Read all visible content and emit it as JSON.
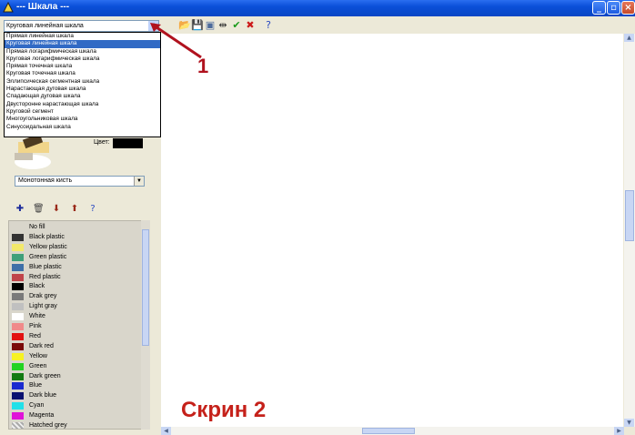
{
  "window": {
    "title": "--- Шкала ---",
    "min_glyph": "_",
    "max_glyph": "▫",
    "close_glyph": "×"
  },
  "scale_type": {
    "selected": "Круговая линейная шкала",
    "options": [
      "Прямая линейная шкала",
      "Круговая линейная шкала",
      "Прямая логарифмическая шкала",
      "Круговая логарифмическая шкала",
      "Прямая точечная шкала",
      "Круговая точечная шкала",
      "Эллипсическая сегментная шкала",
      "Нарастающая дуговая шкала",
      "Спадающая дуговая шкала",
      "Двусторонне нарастающая шкала",
      "Круговой сегмент",
      "Многоугольниковая шкала",
      "Синусоидальная шкала"
    ],
    "highlighted_index": 1
  },
  "toolbar": {
    "icons": [
      "open-icon",
      "save-icon",
      "copy-icon",
      "fit-icon",
      "ok-icon",
      "delete-icon",
      "help-icon"
    ],
    "glyphs": [
      "📂",
      "💾",
      "▣",
      "⇹",
      "✔",
      "✖",
      "?"
    ]
  },
  "annotation": {
    "number": "1",
    "screen_label": "Скрин 2"
  },
  "brush": {
    "color_label": "Цвет:",
    "color_value": "#000000",
    "brush_type": "Монотонная кисть"
  },
  "material_toolbar": {
    "icons": [
      "add-icon",
      "trash-icon",
      "move-down-icon",
      "move-up-icon",
      "help-icon"
    ],
    "glyphs": [
      "✚",
      "🗑",
      "⬇",
      "⬆",
      "?"
    ]
  },
  "materials": [
    {
      "name": "No fill",
      "color": "#d9d6cb"
    },
    {
      "name": "Black plastic",
      "color": "#333333"
    },
    {
      "name": "Yellow plastic",
      "color": "#f2e86a"
    },
    {
      "name": "Green plastic",
      "color": "#3fa07a"
    },
    {
      "name": "Blue plastic",
      "color": "#3e6fa8"
    },
    {
      "name": "Red plastic",
      "color": "#c0444a"
    },
    {
      "name": "Black",
      "color": "#000000"
    },
    {
      "name": "Drak grey",
      "color": "#7a7a7a"
    },
    {
      "name": "Light gray",
      "color": "#c0c0c0"
    },
    {
      "name": "White",
      "color": "#ffffff"
    },
    {
      "name": "Pink",
      "color": "#f08a8a"
    },
    {
      "name": "Red",
      "color": "#e21212"
    },
    {
      "name": "Dark red",
      "color": "#7a0a0a"
    },
    {
      "name": "Yellow",
      "color": "#f7f222"
    },
    {
      "name": "Green",
      "color": "#22d322"
    },
    {
      "name": "Dark green",
      "color": "#127a12"
    },
    {
      "name": "Blue",
      "color": "#1a2ad0"
    },
    {
      "name": "Dark blue",
      "color": "#0a1070"
    },
    {
      "name": "Cyan",
      "color": "#22e0e8"
    },
    {
      "name": "Magenta",
      "color": "#e012d8"
    },
    {
      "name": "Hatched grey",
      "color": "#bbbbbb"
    }
  ]
}
